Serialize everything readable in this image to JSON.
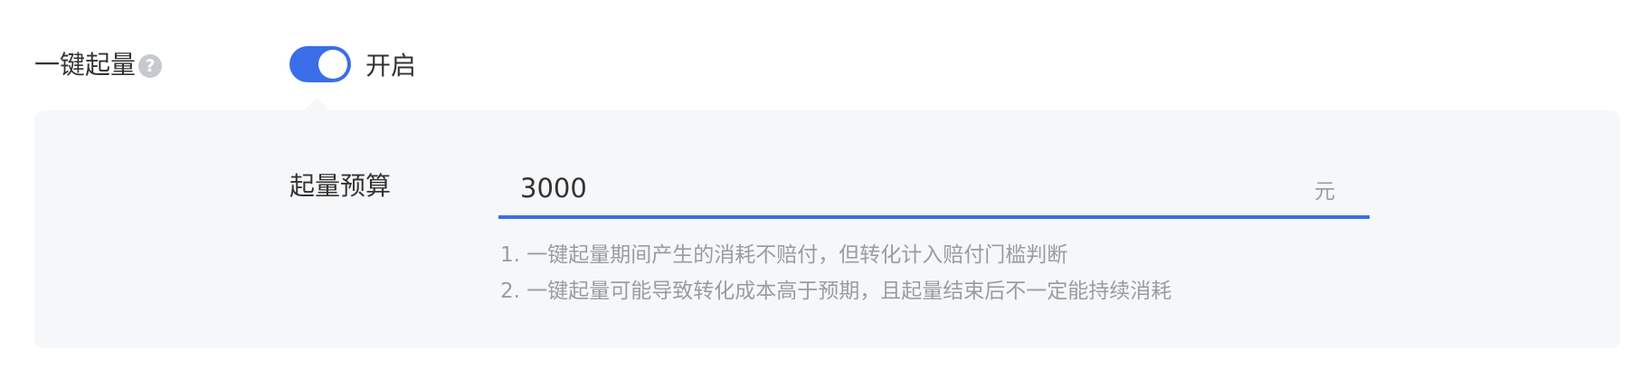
{
  "feature": {
    "label": "一键起量",
    "help_icon_glyph": "?",
    "toggle_on": true,
    "toggle_text": "开启",
    "accent_color": "#3a6ee8"
  },
  "budget": {
    "label": "起量预算",
    "value": "3000",
    "unit": "元"
  },
  "notes": [
    "1. 一键起量期间产生的消耗不赔付，但转化计入赔付门槛判断",
    "2. 一键起量可能导致转化成本高于预期，且起量结束后不一定能持续消耗"
  ]
}
